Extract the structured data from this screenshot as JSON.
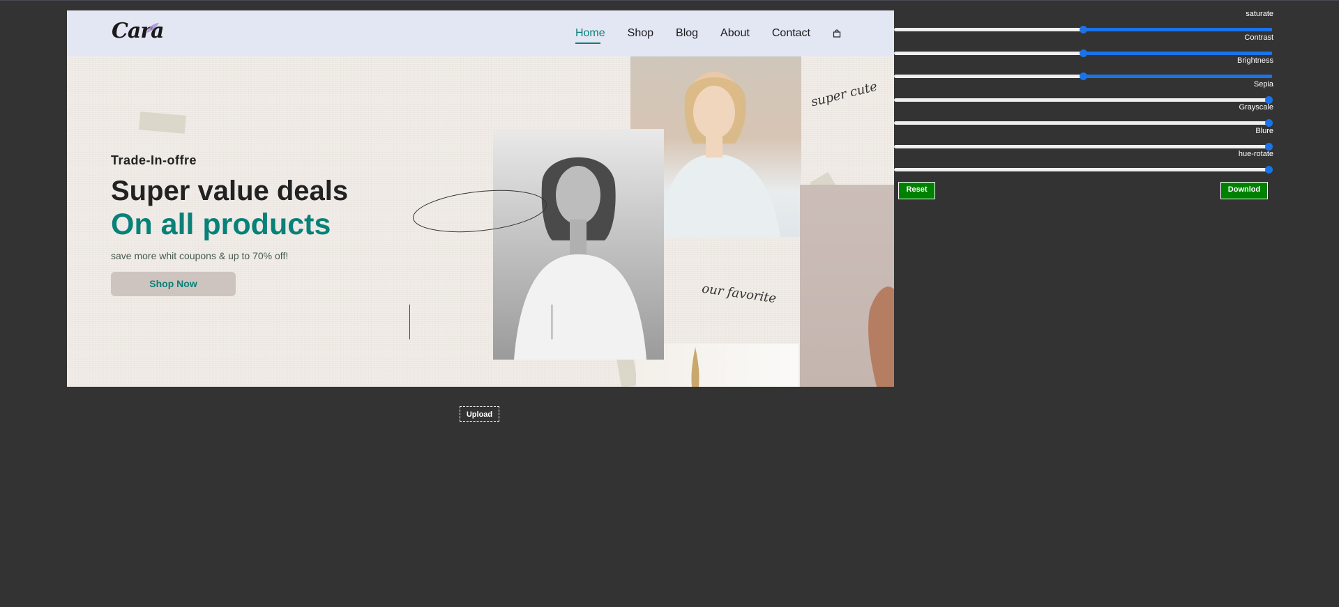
{
  "brand": {
    "logo_text": "Cara"
  },
  "nav": {
    "items": [
      {
        "label": "Home",
        "active": true
      },
      {
        "label": "Shop",
        "active": false
      },
      {
        "label": "Blog",
        "active": false
      },
      {
        "label": "About",
        "active": false
      },
      {
        "label": "Contact",
        "active": false
      }
    ],
    "cart_icon": "shopping-bag-icon"
  },
  "hero": {
    "subtitle": "Trade-In-offre",
    "title_line1": "Super value deals",
    "title_line2": "On all products",
    "description": "save more whit coupons & up to 70% off!",
    "cta_label": "Shop Now",
    "script_1": "super cute",
    "script_2": "our favorite"
  },
  "filters": [
    {
      "label": "saturate",
      "value_fraction": 0.5
    },
    {
      "label": "Contrast",
      "value_fraction": 0.5
    },
    {
      "label": "Brightness",
      "value_fraction": 0.5
    },
    {
      "label": "Sepia",
      "value_fraction": 1.0
    },
    {
      "label": "Grayscale",
      "value_fraction": 1.0
    },
    {
      "label": "Blure",
      "value_fraction": 1.0
    },
    {
      "label": "hue-rotate",
      "value_fraction": 1.0
    }
  ],
  "buttons": {
    "reset_label": "Reset",
    "download_label": "Downlod",
    "upload_label": "Upload"
  },
  "colors": {
    "background": "#333333",
    "accent_teal": "#088178",
    "nav_bg": "#e3e6f3",
    "button_green": "#008000",
    "slider_blue": "#1a73e8"
  }
}
